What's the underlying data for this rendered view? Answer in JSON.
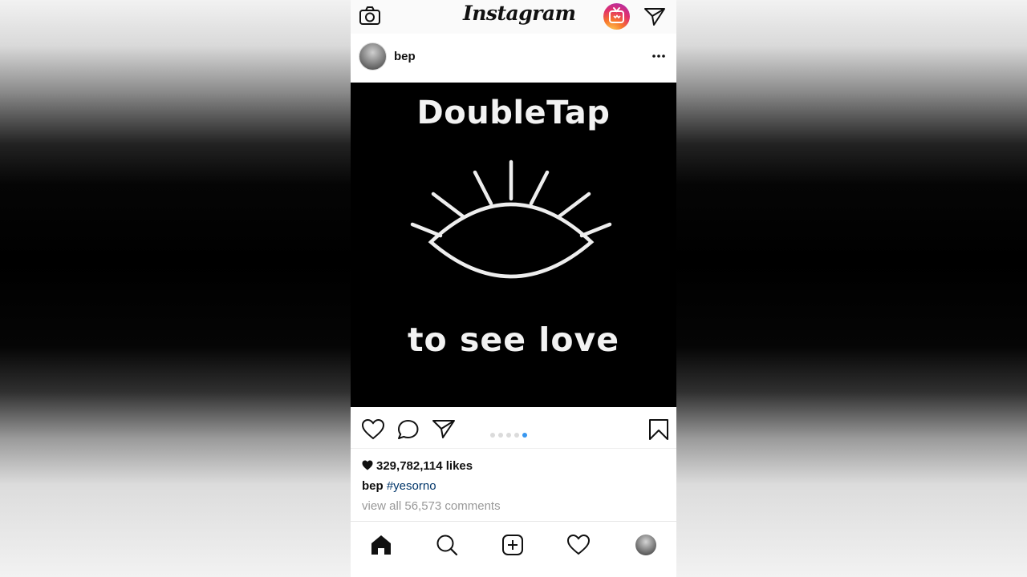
{
  "header": {
    "logo": "Instagram",
    "camera_icon": "camera-icon",
    "igtv_icon": "igtv-icon",
    "direct_icon": "paper-plane-icon",
    "igtv_colors": [
      "#fdd35a",
      "#f8772b",
      "#e1306c",
      "#a12bbd"
    ]
  },
  "post": {
    "username": "bep",
    "more_icon": "ellipsis-icon",
    "image": {
      "title_text": "DoubleTap",
      "subtitle_text": "to see love",
      "graphic": "eye-with-lashes"
    },
    "carousel": {
      "count": 5,
      "active_index": 4,
      "active_color": "#3897f0"
    },
    "actions": {
      "like_icon": "heart-icon",
      "comment_icon": "comment-icon",
      "share_icon": "paper-plane-icon",
      "save_icon": "bookmark-icon"
    },
    "likes": "329,782,114 likes",
    "caption_user": "bep",
    "caption_tag": "#yesorno",
    "comments_link": "view all 56,573 comments"
  },
  "nav": {
    "items": [
      "home-icon",
      "search-icon",
      "add-post-icon",
      "activity-heart-icon",
      "profile-avatar"
    ]
  }
}
